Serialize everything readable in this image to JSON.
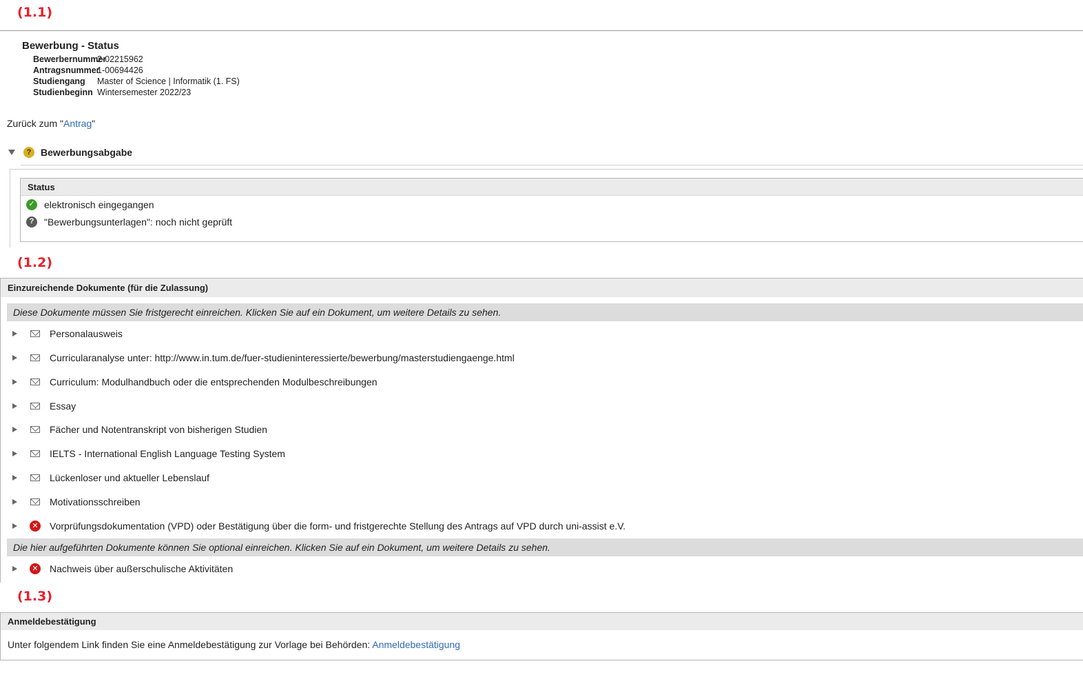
{
  "annotations": [
    "(1.1)",
    "(1.2)",
    "(1.3)"
  ],
  "header": {
    "title": "Bewerbung - Status",
    "fields": [
      {
        "label": "Bewerbernummer",
        "value": "2-02215962"
      },
      {
        "label": "Antragsnummer",
        "value": "1-00694426"
      },
      {
        "label": "Studiengang",
        "value": "Master of Science | Informatik (1. FS)"
      },
      {
        "label": "Studienbeginn",
        "value": "Wintersemester 2022/23"
      }
    ]
  },
  "back": {
    "prefix": "Zurück zum \"",
    "link": "Antrag",
    "suffix": "\""
  },
  "submission": {
    "title": "Bewerbungsabgabe",
    "status_header": "Status",
    "items": [
      {
        "icon": "check-icon",
        "text": "elektronisch eingegangen"
      },
      {
        "icon": "question-icon",
        "text": "\"Bewerbungsunterlagen\": noch nicht geprüft"
      }
    ]
  },
  "documents": {
    "header": "Einzureichende Dokumente (für die Zulassung)",
    "required_notice": "Diese Dokumente müssen Sie fristgerecht einreichen. Klicken Sie auf ein Dokument, um weitere Details zu sehen.",
    "required": [
      {
        "icon": "envelope-icon",
        "label": "Personalausweis"
      },
      {
        "icon": "envelope-icon",
        "label": "Curricularanalyse unter: http://www.in.tum.de/fuer-studieninteressierte/bewerbung/masterstudiengaenge.html"
      },
      {
        "icon": "envelope-icon",
        "label": "Curriculum: Modulhandbuch oder die entsprechenden Modulbeschreibungen"
      },
      {
        "icon": "envelope-icon",
        "label": "Essay"
      },
      {
        "icon": "envelope-icon",
        "label": "Fächer und Notentranskript von bisherigen Studien"
      },
      {
        "icon": "envelope-icon",
        "label": "IELTS - International English Language Testing System"
      },
      {
        "icon": "envelope-icon",
        "label": "Lückenloser und aktueller Lebenslauf"
      },
      {
        "icon": "envelope-icon",
        "label": "Motivationsschreiben"
      },
      {
        "icon": "red-x-icon",
        "label": "Vorprüfungsdokumentation (VPD) oder Bestätigung über die form- und fristgerechte Stellung des Antrags auf VPD durch uni-assist e.V."
      }
    ],
    "optional_notice": "Die hier aufgeführten Dokumente können Sie optional einreichen. Klicken Sie auf ein Dokument, um weitere Details zu sehen.",
    "optional": [
      {
        "icon": "red-x-icon",
        "label": "Nachweis über außerschulische Aktivitäten"
      }
    ]
  },
  "registration": {
    "header": "Anmeldebestätigung",
    "text": "Unter folgendem Link finden Sie eine Anmeldebestätigung zur Vorlage bei Behörden: ",
    "link": "Anmeldebestätigung"
  }
}
